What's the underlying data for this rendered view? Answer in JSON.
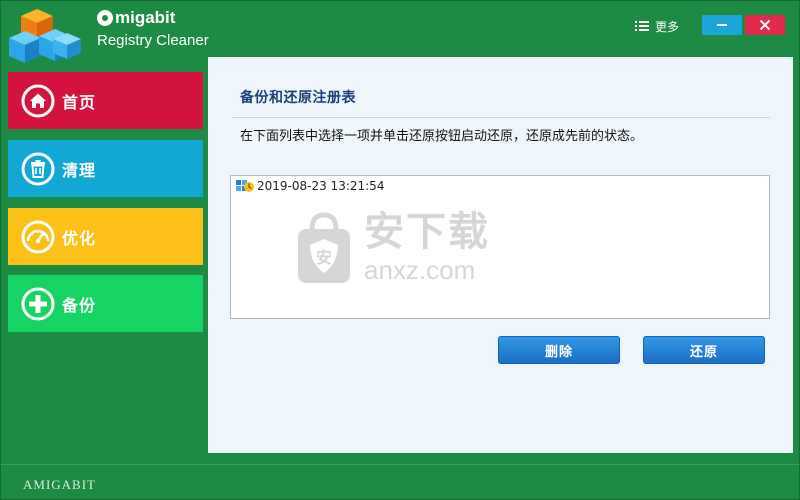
{
  "header": {
    "brand_name": "migabit",
    "product_name": "Registry Cleaner",
    "more_label": "更多"
  },
  "nav": {
    "items": [
      {
        "label": "首页",
        "icon": "home-icon",
        "color": "#d4133f"
      },
      {
        "label": "清理",
        "icon": "trash-icon",
        "color": "#13a7d6"
      },
      {
        "label": "优化",
        "icon": "gauge-icon",
        "color": "#fcc017"
      },
      {
        "label": "备份",
        "icon": "plus-circle-icon",
        "color": "#16d463"
      }
    ]
  },
  "main": {
    "title": "备份和还原注册表",
    "description": "在下面列表中选择一项并单击还原按钮启动还原，还原成先前的状态。",
    "backup_list": [
      {
        "label": "2019-08-23 13:21:54",
        "icon": "registry-backup-icon"
      }
    ],
    "delete_label": "删除",
    "restore_label": "还原"
  },
  "watermark": {
    "cn": "安下载",
    "en": "anxz.com"
  },
  "footer": {
    "brand": "AMIGABIT"
  },
  "colors": {
    "window_bg": "#1e8b44",
    "panel_bg": "#eef6fb",
    "button_blue": "#1b6fc4",
    "title_blue": "#1a3f77"
  }
}
